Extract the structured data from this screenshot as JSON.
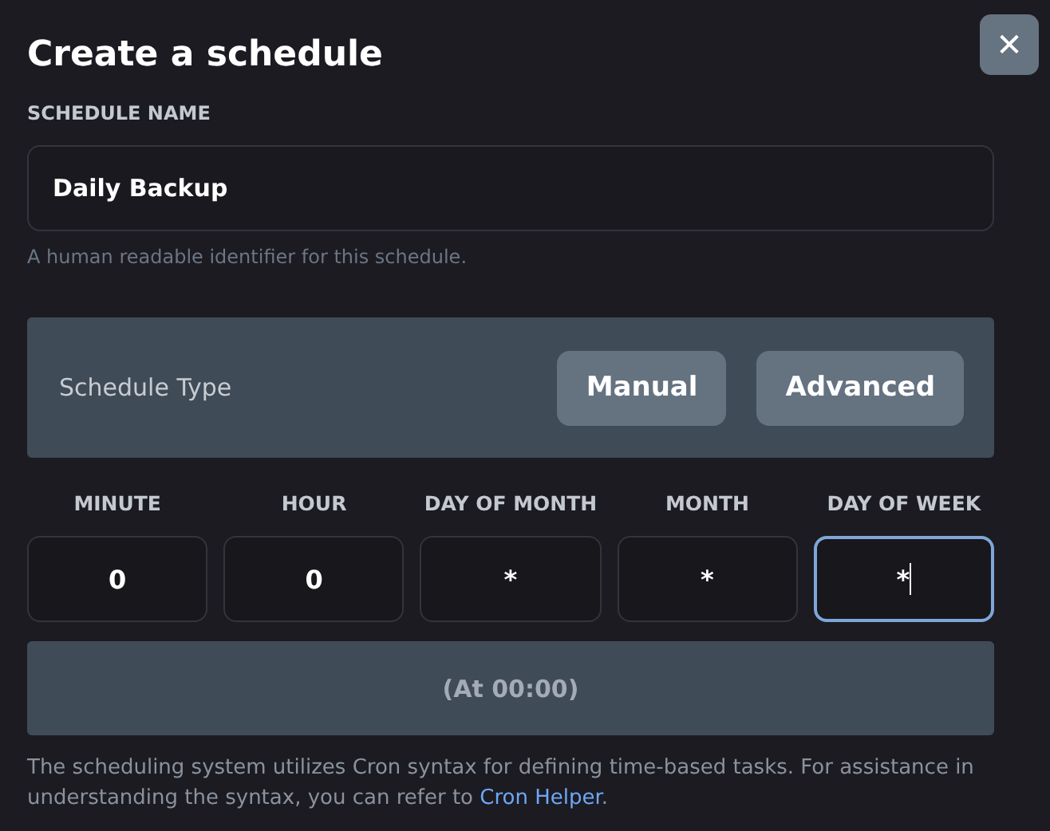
{
  "close_button": {
    "label": "✕"
  },
  "title": "Create a schedule",
  "name_field": {
    "label": "SCHEDULE NAME",
    "value": "Daily Backup",
    "hint": "A human readable identifier for this schedule."
  },
  "schedule_type": {
    "label": "Schedule Type",
    "buttons": [
      "Manual",
      "Advanced"
    ]
  },
  "cron_fields": [
    {
      "label": "MINUTE",
      "value": "0",
      "focused": false
    },
    {
      "label": "HOUR",
      "value": "0",
      "focused": false
    },
    {
      "label": "DAY OF MONTH",
      "value": "*",
      "focused": false
    },
    {
      "label": "MONTH",
      "value": "*",
      "focused": false
    },
    {
      "label": "DAY OF WEEK",
      "value": "*",
      "focused": true
    }
  ],
  "summary": "(At 00:00)",
  "help": {
    "text": "The scheduling system utilizes Cron syntax for defining time-based tasks. For assistance in understanding the syntax, you can refer to ",
    "link": "Cron Helper",
    "after": "."
  }
}
